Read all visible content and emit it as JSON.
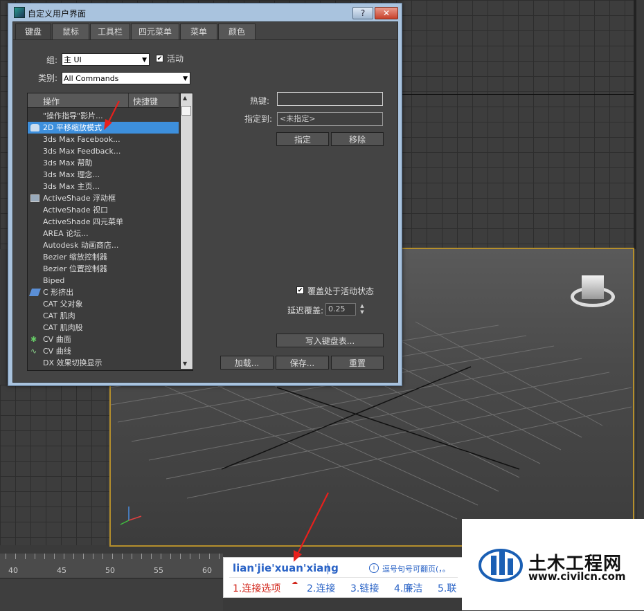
{
  "dialog": {
    "title": "自定义用户界面",
    "help_btn": "?",
    "close_btn": "✕",
    "tabs": [
      "键盘",
      "鼠标",
      "工具栏",
      "四元菜单",
      "菜单",
      "颜色"
    ],
    "group_label": "组:",
    "group_value": "主 UI",
    "active_label": "活动",
    "category_label": "类别:",
    "category_value": "All Commands",
    "list_headers": {
      "action": "操作",
      "shortcut": "快捷键"
    },
    "list_items": [
      "\"操作指导\"影片...",
      "2D 平移缩放模式",
      "3ds Max Facebook...",
      "3ds Max Feedback...",
      "3ds Max 帮助",
      "3ds Max 理念...",
      "3ds Max 主页...",
      "ActiveShade 浮动框",
      "ActiveShade 视口",
      "ActiveShade 四元菜单",
      "AREA 论坛...",
      "Autodesk 动画商店...",
      "Bezier 缩放控制器",
      "Bezier 位置控制器",
      "Biped",
      "C 形挤出",
      "CAT 父对象",
      "CAT 肌肉",
      "CAT 肌肉股",
      "CV 曲面",
      "CV 曲线",
      "DX 效果切换显示"
    ],
    "hotkey_label": "热键:",
    "hotkey_value": "",
    "assigned_label": "指定到:",
    "assigned_value": "<未指定>",
    "assign_btn": "指定",
    "remove_btn": "移除",
    "override_label": "覆盖处于活动状态",
    "delay_label": "延迟覆盖:",
    "delay_value": "0.25",
    "write_btn": "写入键盘表...",
    "load_btn": "加载...",
    "save_btn": "保存...",
    "reset_btn": "重置"
  },
  "ruler": {
    "numbers": [
      "40",
      "45",
      "50",
      "55",
      "60"
    ]
  },
  "ime": {
    "pinyin": "lian'jie'xuan'xiang",
    "hint": "逗号句号可翻页(，。",
    "candidates": [
      "1.连接选项",
      "2.连接",
      "3.链接",
      "4.廉洁",
      "5.联"
    ]
  },
  "watermark": {
    "name": "土木工程网",
    "url": "www.civilcn.com"
  },
  "colors": {
    "selection": "#3d8fdc",
    "annotation": "#e8201c",
    "viewport_border": "#b58f2c"
  }
}
